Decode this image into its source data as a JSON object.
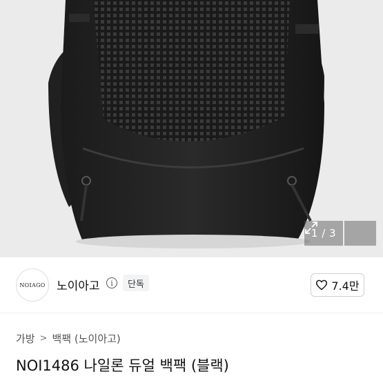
{
  "gallery": {
    "counter": "1 / 3",
    "expand_icon": "expand-icon"
  },
  "shop": {
    "logo_text": "NOIAGO",
    "name": "노이아고",
    "info_icon_glyph": "i",
    "badge": "단독",
    "like_count": "7.4만",
    "heart_icon": "heart-outline-icon"
  },
  "breadcrumb": {
    "items": [
      "가방",
      "백팩 (노이아고)"
    ],
    "separator": ">"
  },
  "product": {
    "title": "NOI1486 나일론 듀얼 백팩 (블랙)"
  },
  "colors": {
    "hero_background": "#ebebeb",
    "accent_text": "#111111"
  }
}
